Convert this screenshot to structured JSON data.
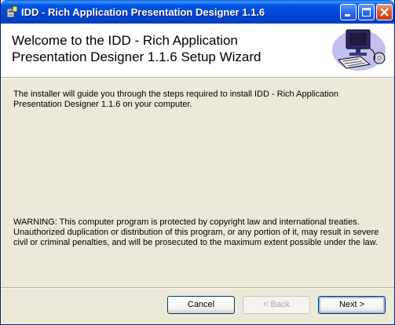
{
  "window": {
    "title": "IDD - Rich Application Presentation Designer 1.1.6",
    "controls": {
      "minimize": "minimize-icon",
      "maximize": "maximize-icon",
      "close": "close-icon"
    }
  },
  "banner": {
    "title": "Welcome to the IDD - Rich Application Presentation Designer 1.1.6 Setup Wizard",
    "image": "computer-setup-icon"
  },
  "content": {
    "intro": "The installer will guide you through the steps required to install IDD - Rich Application Presentation Designer 1.1.6 on your computer.",
    "warning": "WARNING: This computer program is protected by copyright law and international treaties. Unauthorized duplication or distribution of this program, or any portion of it, may result in severe civil or criminal penalties, and will be prosecuted to the maximum extent possible under the law."
  },
  "buttons": {
    "cancel": "Cancel",
    "back": "< Back",
    "next": "Next >"
  }
}
